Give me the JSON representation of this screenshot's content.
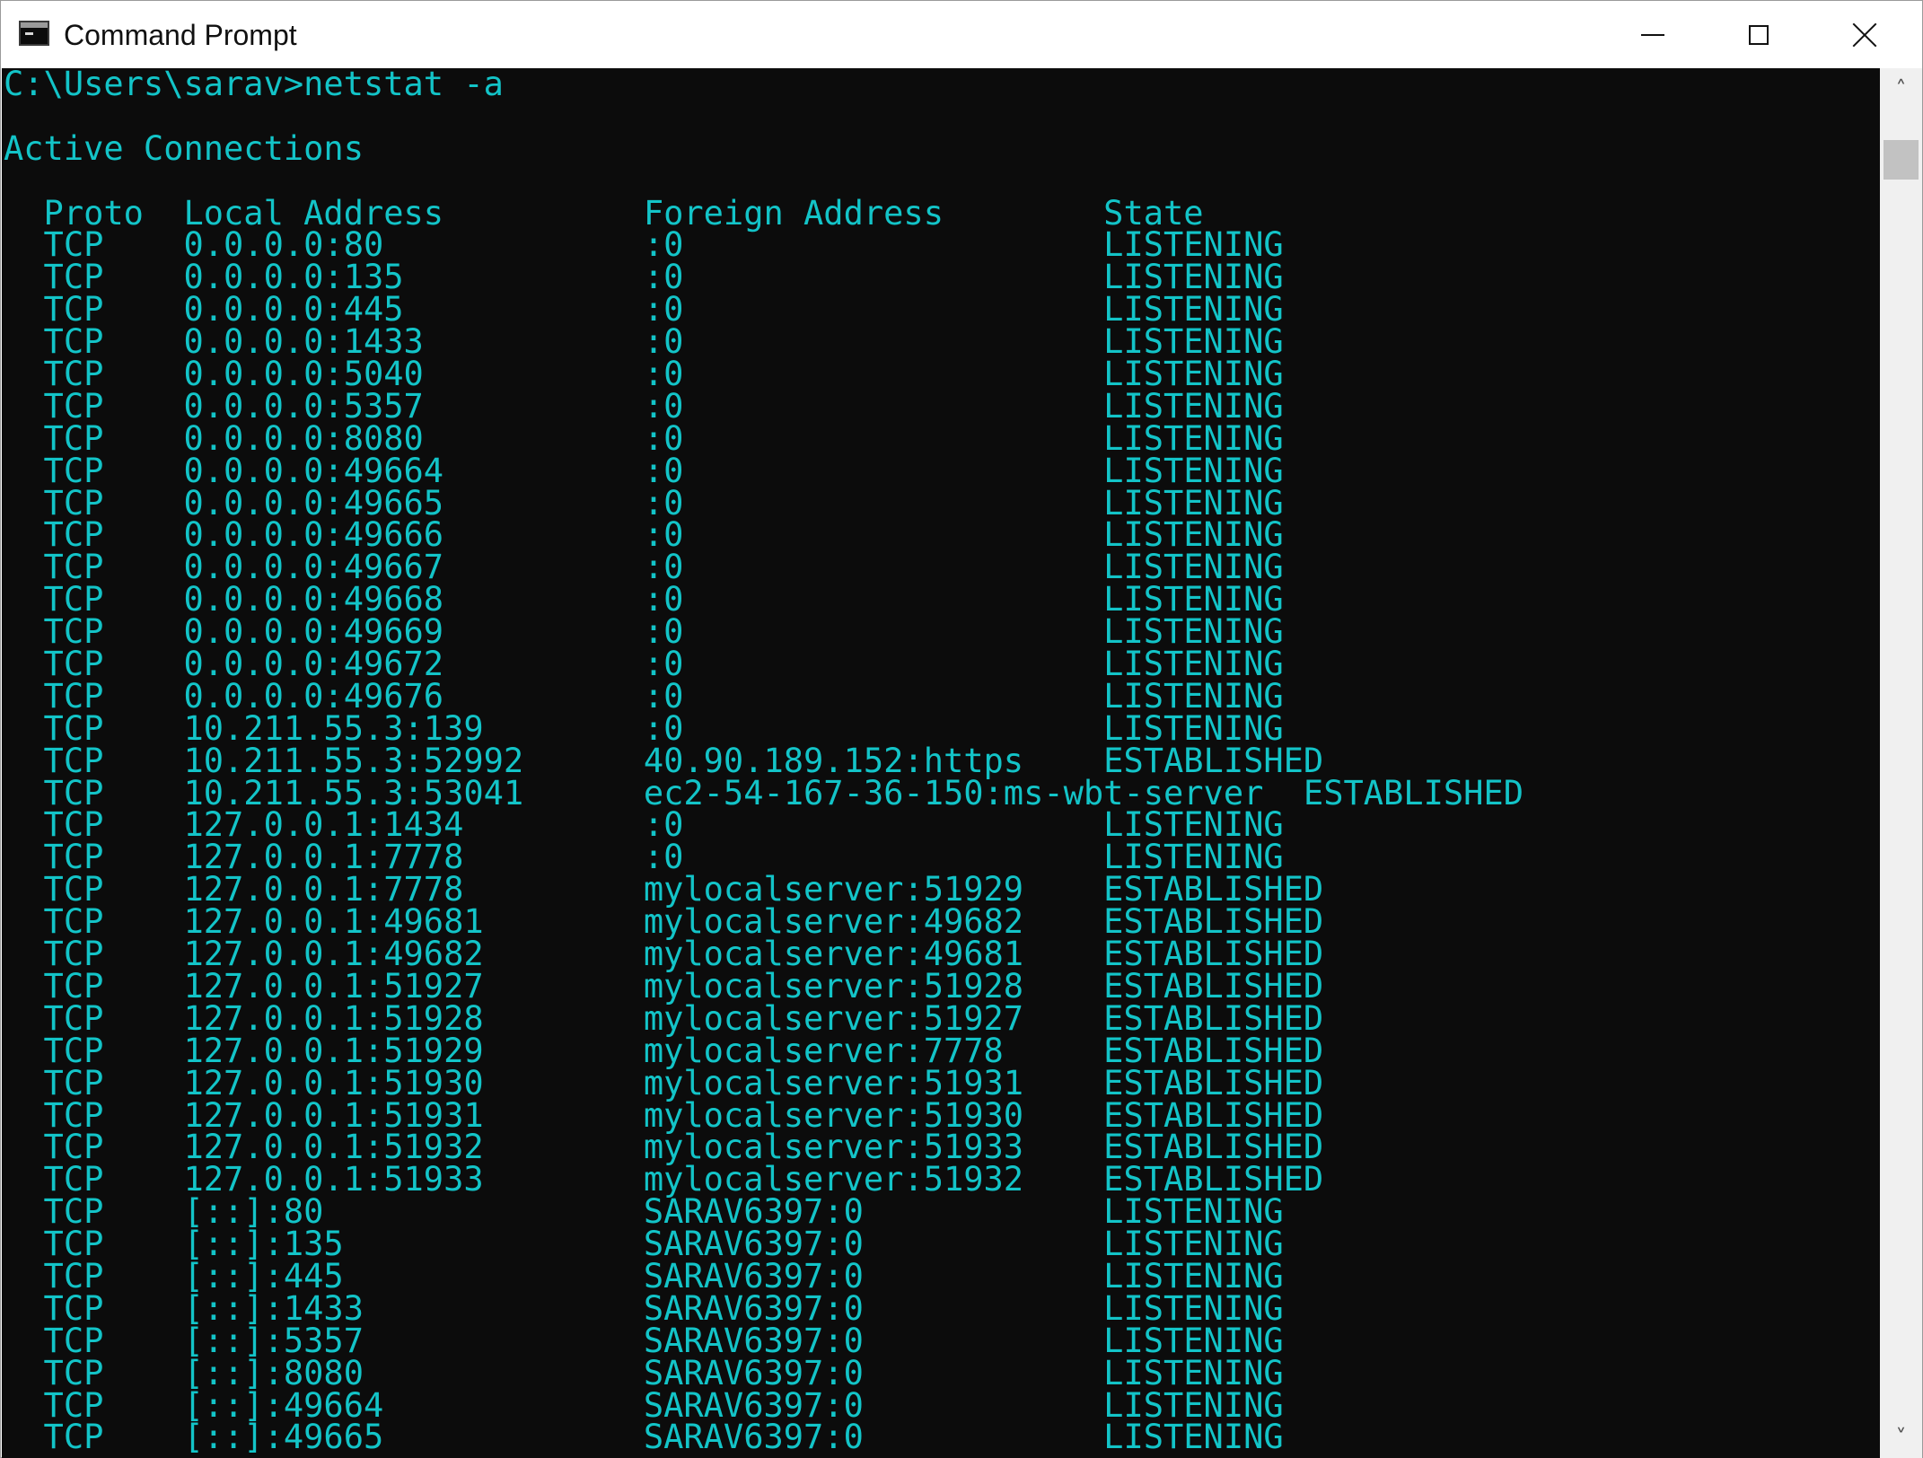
{
  "window": {
    "title": "Command Prompt",
    "controls": {
      "minimize": "minimize",
      "maximize": "maximize",
      "close": "close"
    }
  },
  "colors": {
    "console_background": "#0c0c0c",
    "console_text": "#13c4c8",
    "titlebar_background": "#ffffff",
    "scrollbar_track": "#f0f0f0",
    "scrollbar_thumb": "#c2c2c2"
  },
  "console": {
    "lines": [
      "C:\\Users\\sarav>netstat -a",
      "",
      "Active Connections",
      "",
      "  Proto  Local Address          Foreign Address        State",
      "  TCP    0.0.0.0:80             :0                     LISTENING",
      "  TCP    0.0.0.0:135            :0                     LISTENING",
      "  TCP    0.0.0.0:445            :0                     LISTENING",
      "  TCP    0.0.0.0:1433           :0                     LISTENING",
      "  TCP    0.0.0.0:5040           :0                     LISTENING",
      "  TCP    0.0.0.0:5357           :0                     LISTENING",
      "  TCP    0.0.0.0:8080           :0                     LISTENING",
      "  TCP    0.0.0.0:49664          :0                     LISTENING",
      "  TCP    0.0.0.0:49665          :0                     LISTENING",
      "  TCP    0.0.0.0:49666          :0                     LISTENING",
      "  TCP    0.0.0.0:49667          :0                     LISTENING",
      "  TCP    0.0.0.0:49668          :0                     LISTENING",
      "  TCP    0.0.0.0:49669          :0                     LISTENING",
      "  TCP    0.0.0.0:49672          :0                     LISTENING",
      "  TCP    0.0.0.0:49676          :0                     LISTENING",
      "  TCP    10.211.55.3:139        :0                     LISTENING",
      "  TCP    10.211.55.3:52992      40.90.189.152:https    ESTABLISHED",
      "  TCP    10.211.55.3:53041      ec2-54-167-36-150:ms-wbt-server  ESTABLISHED",
      "  TCP    127.0.0.1:1434         :0                     LISTENING",
      "  TCP    127.0.0.1:7778         :0                     LISTENING",
      "  TCP    127.0.0.1:7778         mylocalserver:51929    ESTABLISHED",
      "  TCP    127.0.0.1:49681        mylocalserver:49682    ESTABLISHED",
      "  TCP    127.0.0.1:49682        mylocalserver:49681    ESTABLISHED",
      "  TCP    127.0.0.1:51927        mylocalserver:51928    ESTABLISHED",
      "  TCP    127.0.0.1:51928        mylocalserver:51927    ESTABLISHED",
      "  TCP    127.0.0.1:51929        mylocalserver:7778     ESTABLISHED",
      "  TCP    127.0.0.1:51930        mylocalserver:51931    ESTABLISHED",
      "  TCP    127.0.0.1:51931        mylocalserver:51930    ESTABLISHED",
      "  TCP    127.0.0.1:51932        mylocalserver:51933    ESTABLISHED",
      "  TCP    127.0.0.1:51933        mylocalserver:51932    ESTABLISHED",
      "  TCP    [::]:80                SARAV6397:0            LISTENING",
      "  TCP    [::]:135               SARAV6397:0            LISTENING",
      "  TCP    [::]:445               SARAV6397:0            LISTENING",
      "  TCP    [::]:1433              SARAV6397:0            LISTENING",
      "  TCP    [::]:5357              SARAV6397:0            LISTENING",
      "  TCP    [::]:8080              SARAV6397:0            LISTENING",
      "  TCP    [::]:49664             SARAV6397:0            LISTENING",
      "  TCP    [::]:49665             SARAV6397:0            LISTENING"
    ]
  },
  "scrollbar": {
    "up_icon": "chevron-up-icon",
    "down_icon": "chevron-down-icon"
  }
}
